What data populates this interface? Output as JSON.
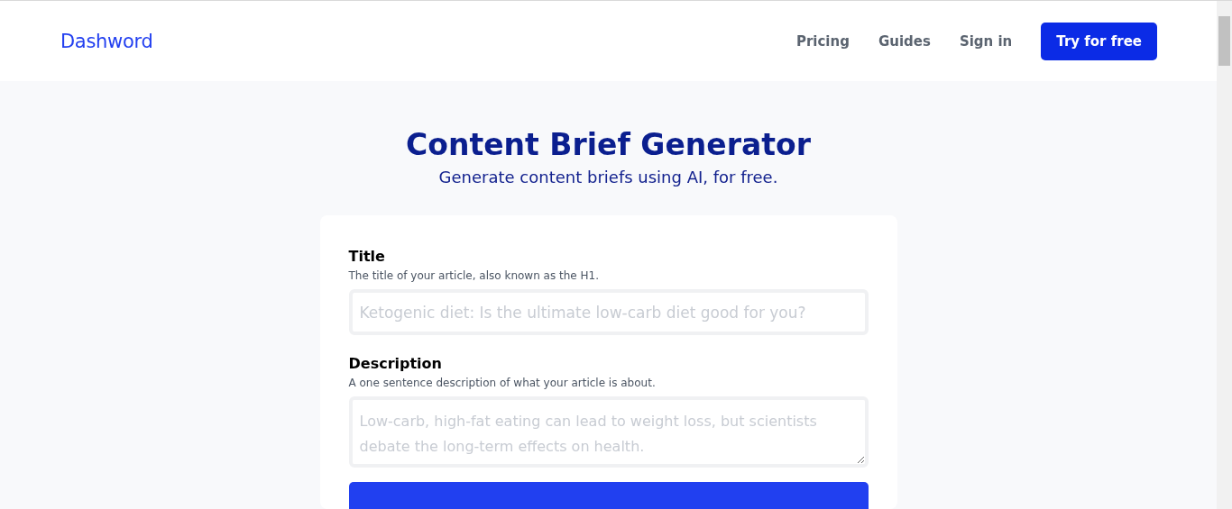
{
  "header": {
    "logo": "Dashword",
    "nav": [
      "Pricing",
      "Guides",
      "Sign in"
    ],
    "cta": "Try for free"
  },
  "hero": {
    "title": "Content Brief Generator",
    "subtitle": "Generate content briefs using AI, for free."
  },
  "form": {
    "fields": [
      {
        "kind": "input",
        "label": "Title",
        "hint": "The title of your article, also known as the H1.",
        "placeholder": "Ketogenic diet: Is the ultimate low-carb diet good for you?"
      },
      {
        "kind": "textarea",
        "label": "Description",
        "hint": "A one sentence description of what your article is about.",
        "placeholder": "Low-carb, high-fat eating can lead to weight loss, but scientists debate the long-term effects on health."
      }
    ]
  }
}
